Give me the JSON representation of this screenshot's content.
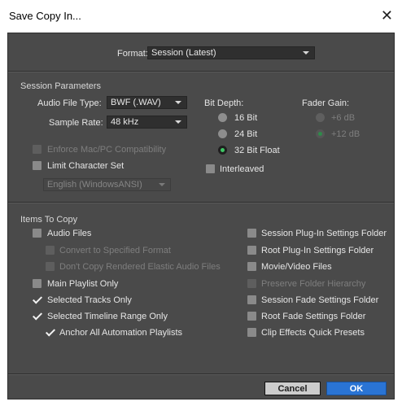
{
  "window": {
    "title": "Save Copy In...",
    "close_glyph": "✕"
  },
  "format": {
    "label": "Format:",
    "value": "Session (Latest)"
  },
  "session_parameters": {
    "header": "Session Parameters",
    "audio_file_type_label": "Audio File Type:",
    "audio_file_type_value": "BWF (.WAV)",
    "sample_rate_label": "Sample Rate:",
    "sample_rate_value": "48 kHz",
    "enforce_compat": "Enforce Mac/PC Compatibility",
    "limit_charset": "Limit Character Set",
    "charset_value": "English (WindowsANSI)",
    "bit_depth_label": "Bit Depth:",
    "bit_16": "16 Bit",
    "bit_24": "24 Bit",
    "bit_32f": "32 Bit Float",
    "interleaved": "Interleaved",
    "fader_gain_label": "Fader Gain:",
    "gain_6": "+6 dB",
    "gain_12": "+12 dB"
  },
  "items_to_copy": {
    "header": "Items To Copy",
    "audio_files": "Audio Files",
    "convert_format": "Convert to Specified Format",
    "dont_copy_elastic": "Don't Copy Rendered Elastic Audio Files",
    "main_playlist_only": "Main Playlist Only",
    "selected_tracks_only": "Selected Tracks Only",
    "selected_timeline_range": "Selected Timeline Range Only",
    "anchor_automation": "Anchor All Automation Playlists",
    "session_plugin_settings": "Session Plug-In Settings Folder",
    "root_plugin_settings": "Root Plug-In Settings Folder",
    "movie_video_files": "Movie/Video Files",
    "preserve_folder_hierarchy": "Preserve Folder Hierarchy",
    "session_fade_settings": "Session Fade Settings Folder",
    "root_fade_settings": "Root Fade Settings Folder",
    "clip_effects_presets": "Clip Effects Quick Presets"
  },
  "buttons": {
    "cancel": "Cancel",
    "ok": "OK"
  },
  "colors": {
    "panel": "#4a4a4a",
    "accent_ok": "#2a74d4",
    "radio_selected": "#3ec765"
  }
}
